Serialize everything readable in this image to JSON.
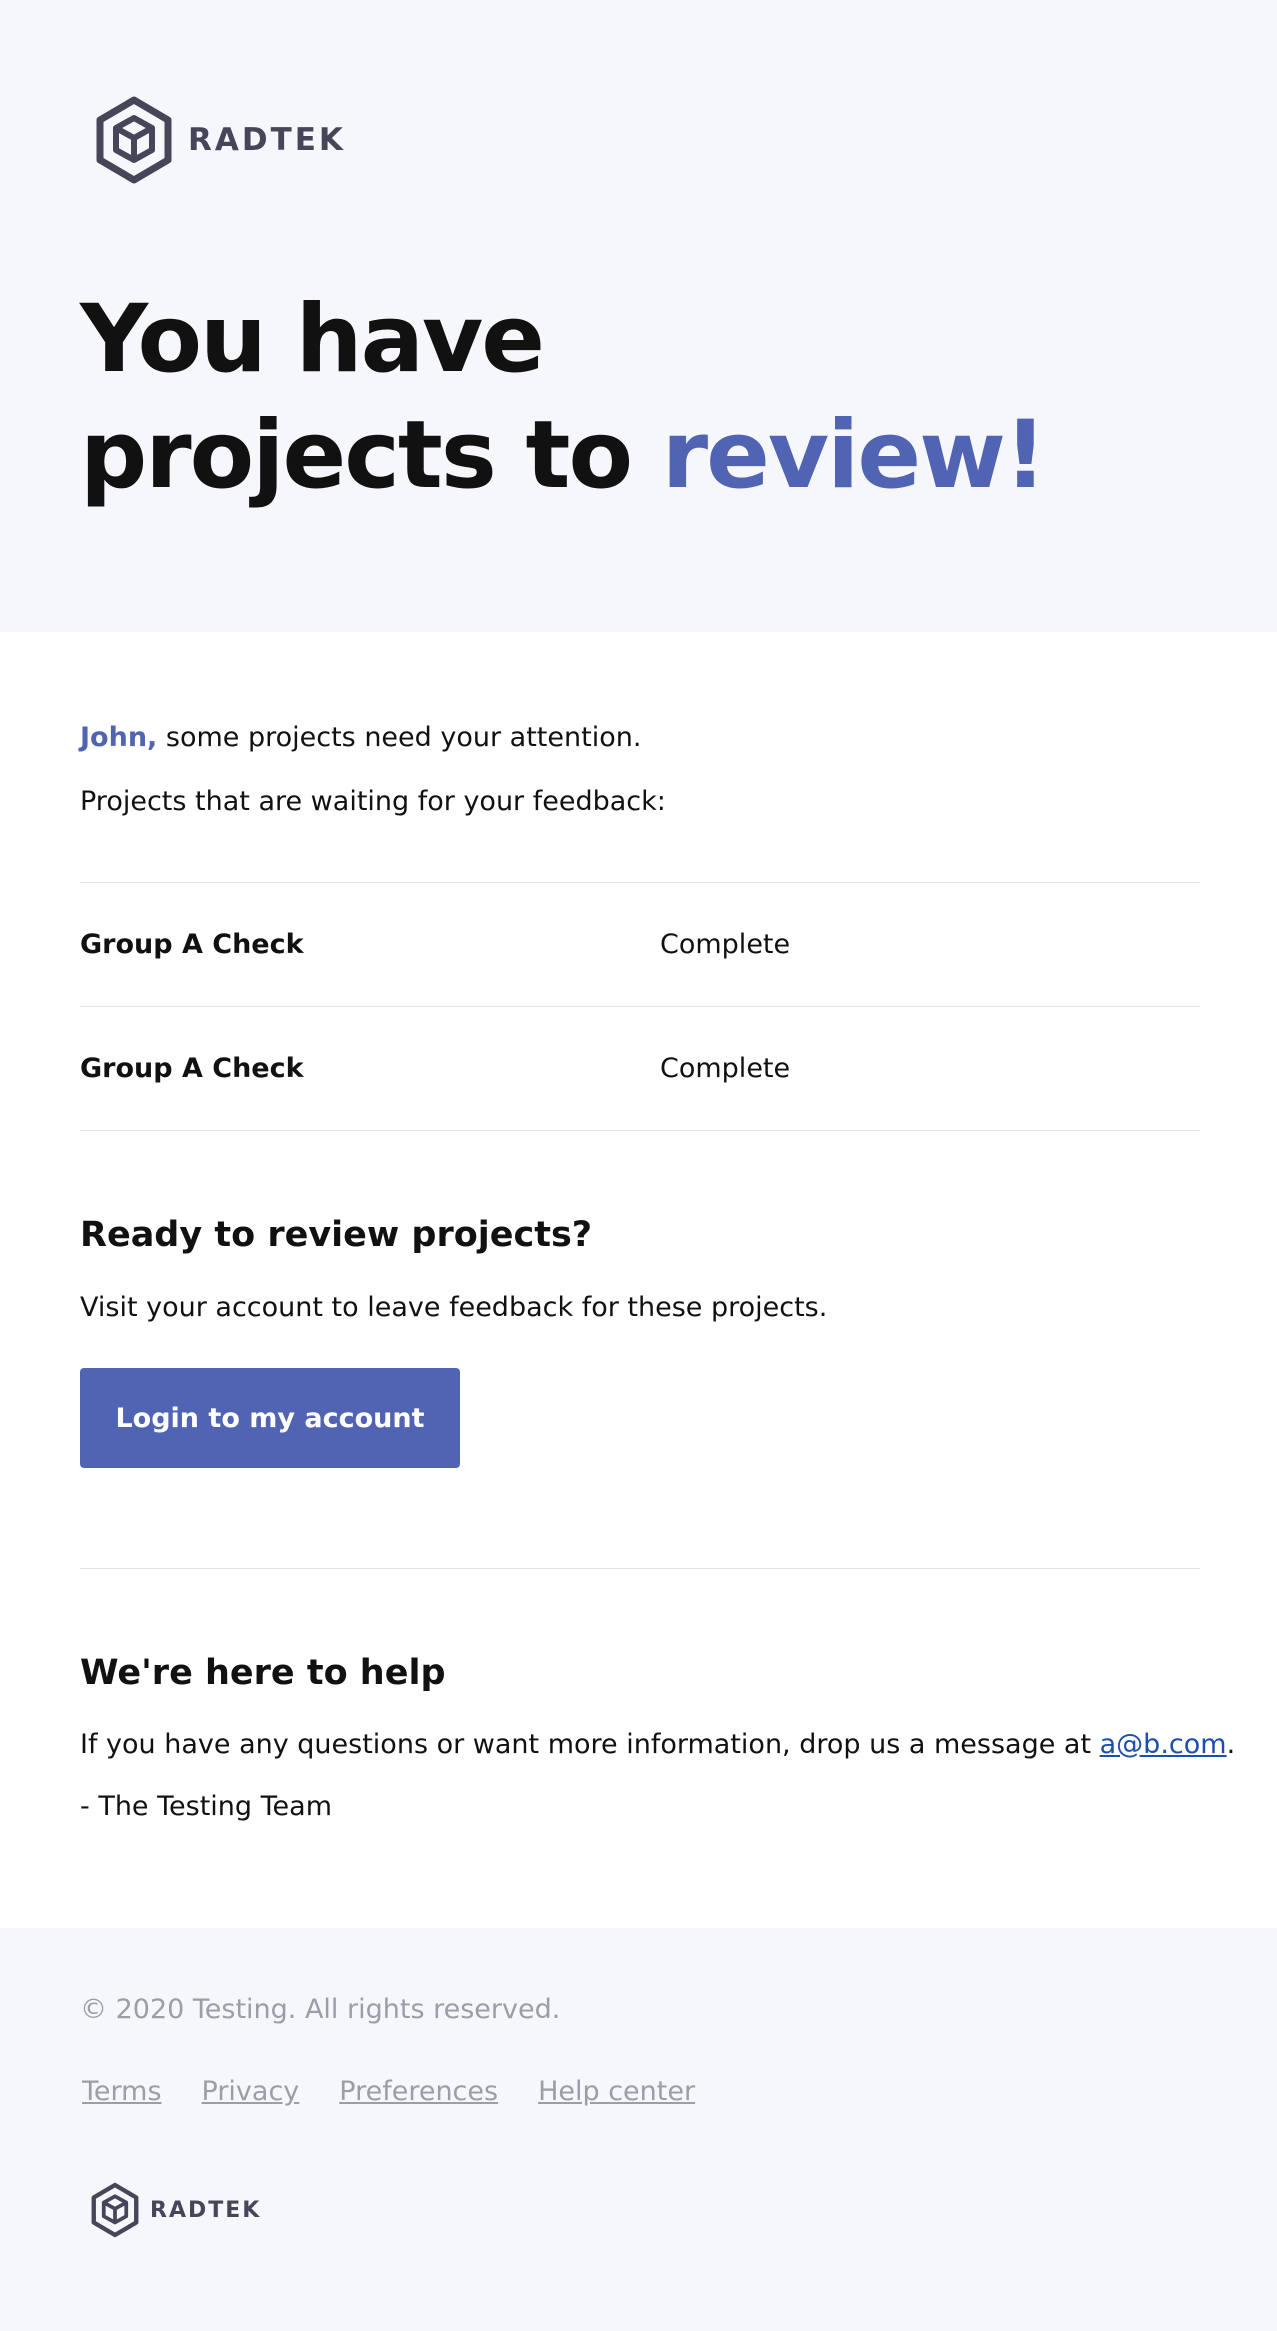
{
  "brand": {
    "name": "RADTEK",
    "color": "#45465a",
    "accent_color": "#5163b3"
  },
  "hero": {
    "line1": "You have",
    "line2_prefix": "projects to ",
    "line2_accent": "review!"
  },
  "intro": {
    "name": "John,",
    "message": " some projects need your attention.",
    "waiting": "Projects that are waiting for your feedback:"
  },
  "projects": [
    {
      "name": "Group A Check",
      "status": "Complete"
    },
    {
      "name": "Group A Check",
      "status": "Complete"
    }
  ],
  "ready": {
    "title": "Ready to review projects?",
    "text": "Visit your account to leave feedback for these projects.",
    "button_label": "Login to my account"
  },
  "help": {
    "title": "We're here to help",
    "text_prefix": "If you have any questions or want more information, drop us a message at ",
    "email": "a@b.com",
    "text_suffix": ".",
    "signoff": "- The Testing Team"
  },
  "footer": {
    "copyright": "© 2020 Testing. All rights reserved.",
    "links": [
      "Terms",
      "Privacy",
      "Preferences",
      "Help center"
    ],
    "brand_name": "RADTEK"
  }
}
